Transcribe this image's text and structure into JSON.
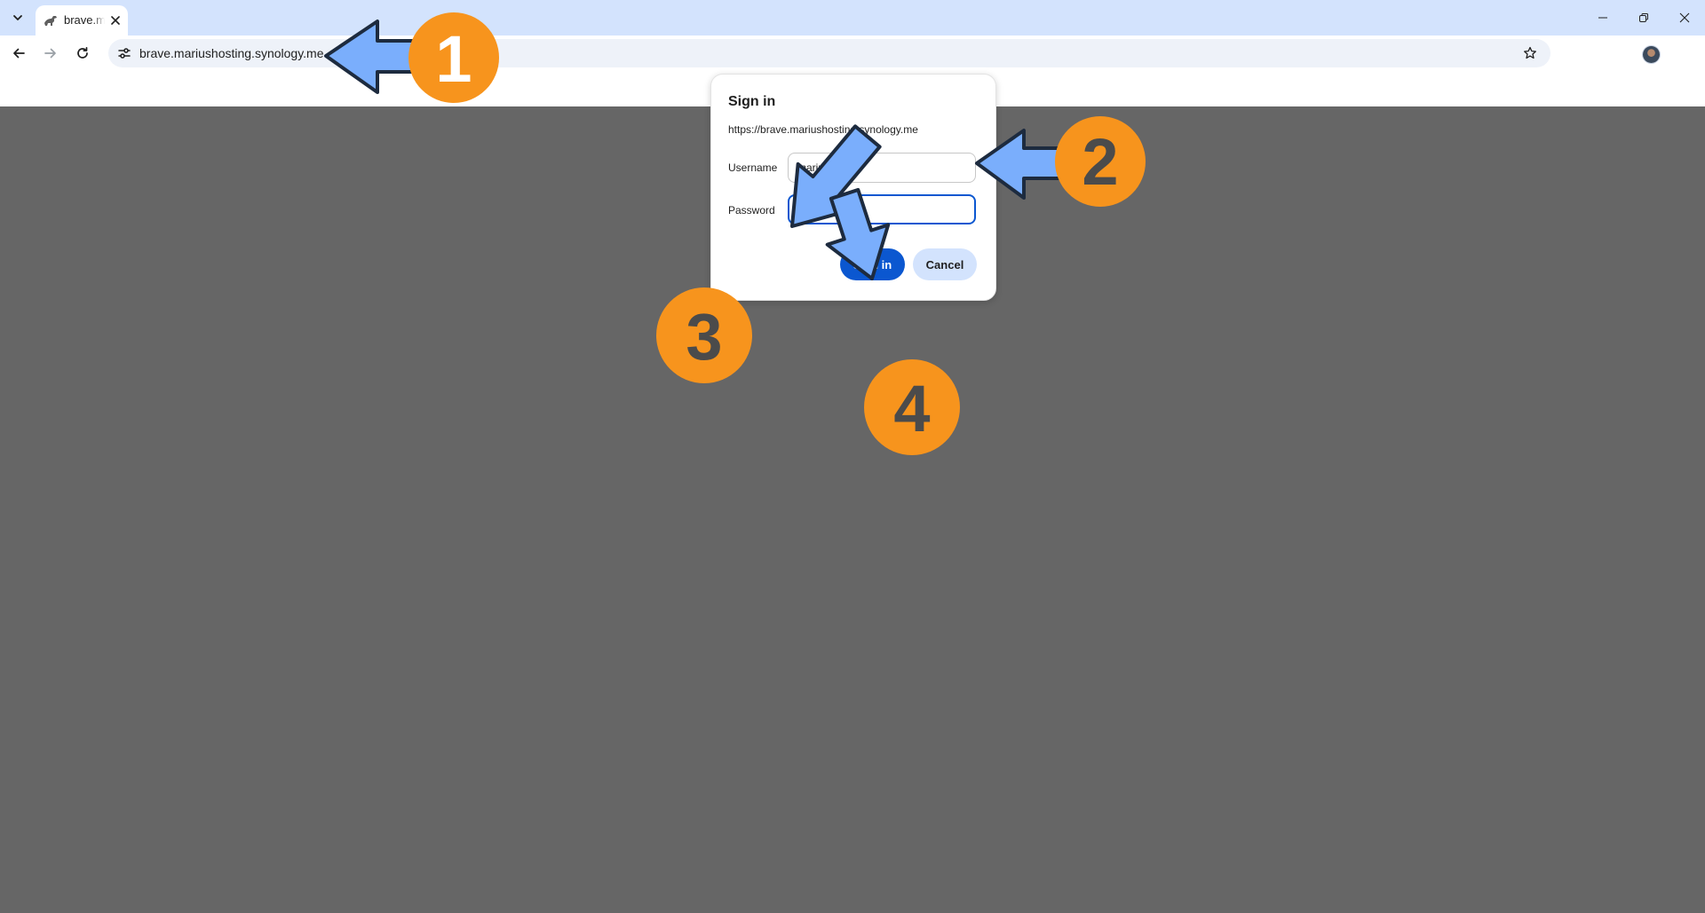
{
  "browser": {
    "tab": {
      "title": "brave.mariushosting.synology.me",
      "favicon": "dinosaur-favicon-icon"
    },
    "address_bar": {
      "url": "brave.mariushosting.synology.me"
    },
    "window_controls": [
      "minimize-icon",
      "restore-icon",
      "close-icon"
    ]
  },
  "dialog": {
    "title": "Sign in",
    "origin": "https://brave.mariushosting.synology.me",
    "username_label": "Username",
    "username_value": "marius",
    "password_label": "Password",
    "password_value": "•••••••••••••",
    "sign_in_label": "Sign in",
    "cancel_label": "Cancel"
  },
  "annotations": {
    "step_1": "1",
    "step_2": "2",
    "step_3": "3",
    "step_4": "4"
  },
  "colors": {
    "page_background": "#666666",
    "tabstrip": "#d3e3fd",
    "accent": "#0b57d0",
    "badge": "#f7941d",
    "arrow_fill": "#7aaefc",
    "arrow_stroke": "#1d2b3f",
    "badge_digit": "#ffffff",
    "badge_digit_dark": "#4b4b4b"
  }
}
